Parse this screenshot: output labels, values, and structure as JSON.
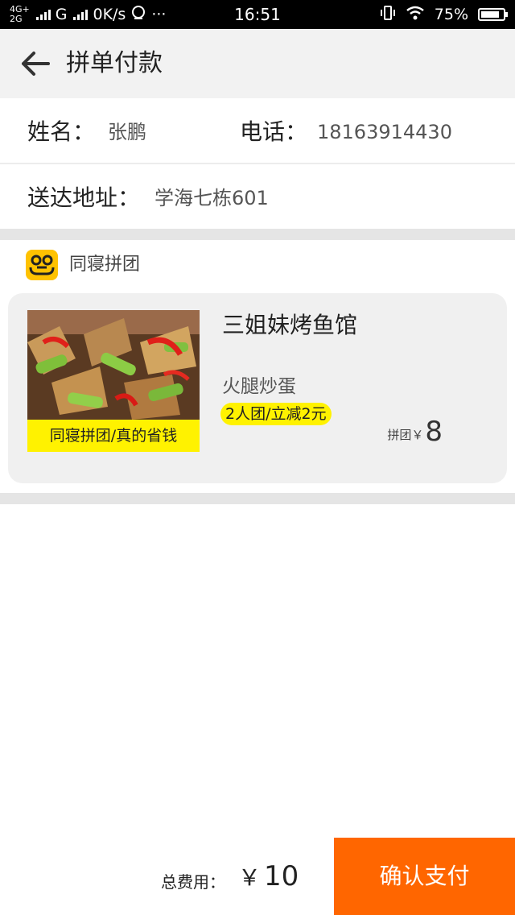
{
  "status_bar": {
    "network_top": "4G+",
    "network_bottom": "2G",
    "network_g": "G",
    "speed": "0K/s",
    "dots": "···",
    "time": "16:51",
    "battery": "75%"
  },
  "header": {
    "title": "拼单付款"
  },
  "contact": {
    "name_label": "姓名：",
    "name_value": "张鹏",
    "phone_label": "电话：",
    "phone_value": "18163914430",
    "address_label": "送达地址：",
    "address_value": "学海七栋601"
  },
  "group": {
    "name": "同寝拼团",
    "logo_icon": "group-logo-icon",
    "logo_color": "#ffc200"
  },
  "order": {
    "image_caption": "同寝拼团/真的省钱",
    "shop_name": "三姐妹烤鱼馆",
    "dish_name": "火腿炒蛋",
    "promo": "2人团/立减2元",
    "price_label": "拼团￥",
    "price_value": "8"
  },
  "footer": {
    "total_label": "总费用：",
    "currency": "￥",
    "total_value": "10",
    "pay_label": "确认支付",
    "pay_color": "#ff6600"
  }
}
